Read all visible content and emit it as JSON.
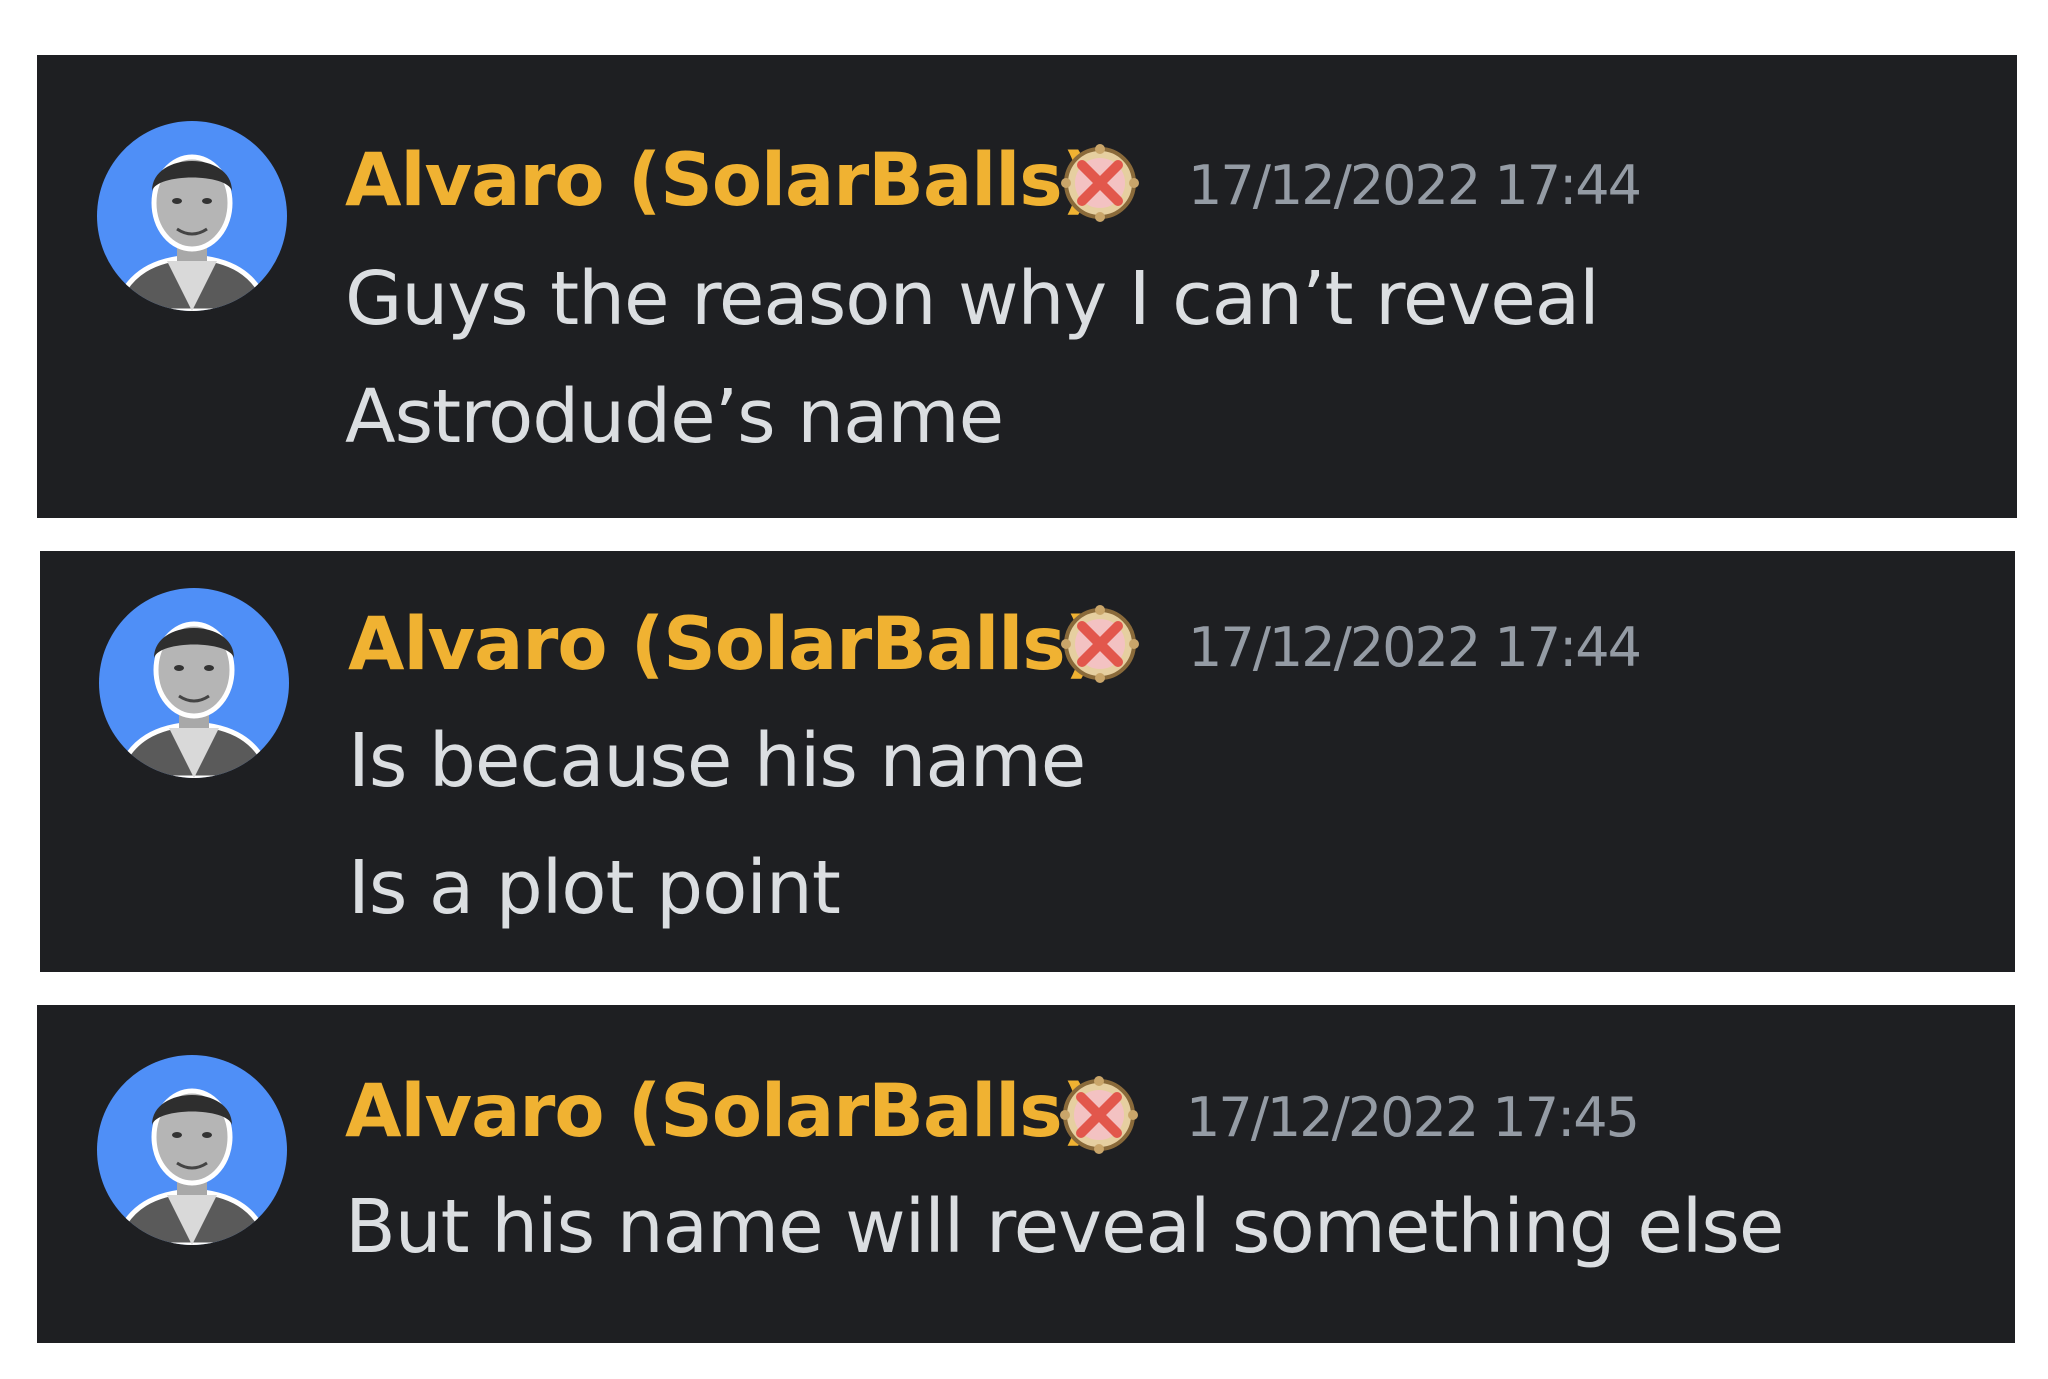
{
  "messages": [
    {
      "author": "Alvaro (SolarBalls)",
      "badge_icon": "crossed-swords-badge-icon",
      "timestamp": "17/12/2022 17:44",
      "lines": [
        "Guys the reason why I can’t reveal",
        "Astrodude’s name"
      ]
    },
    {
      "author": "Alvaro (SolarBalls)",
      "badge_icon": "crossed-swords-badge-icon",
      "timestamp": "17/12/2022 17:44",
      "lines": [
        "Is because his name",
        "Is a plot point"
      ]
    },
    {
      "author": "Alvaro (SolarBalls)",
      "badge_icon": "crossed-swords-badge-icon",
      "timestamp": "17/12/2022 17:45",
      "lines": [
        "But his name will reveal something else"
      ]
    }
  ],
  "colors": {
    "background": "#1e1f22",
    "author": "#f0b232",
    "timestamp": "#949ba4",
    "text": "#dbdee1",
    "avatar_bg": "#4f8ff7"
  }
}
